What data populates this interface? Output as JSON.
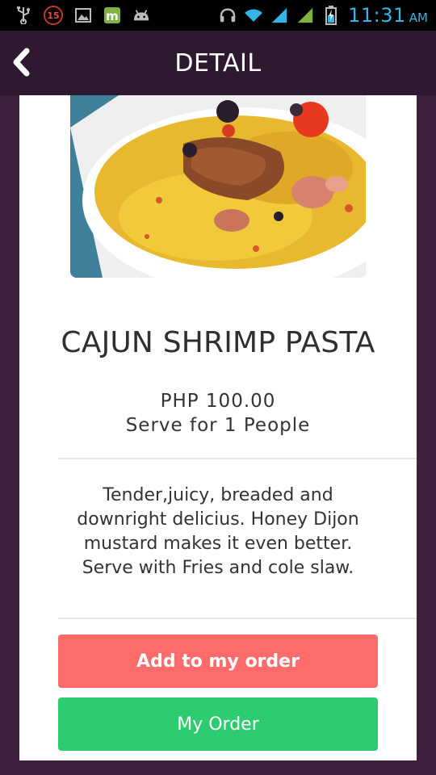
{
  "status_bar": {
    "notification_count": "15",
    "time": "11:31",
    "ampm": "AM",
    "icons": [
      "usb-icon",
      "notification-badge",
      "image-icon",
      "app-icon",
      "android-icon",
      "headset-icon",
      "wifi-icon",
      "signal-icon",
      "signal-icon",
      "battery-charging-icon"
    ],
    "accent_color": "#33b5e5"
  },
  "header": {
    "title": "DETAIL",
    "back_icon": "chevron-left-icon",
    "background": "#2e1931"
  },
  "dish": {
    "name": "CAJUN SHRIMP PASTA",
    "price": "PHP 100.00",
    "serving": "Serve for 1 People",
    "description": "Tender,juicy, breaded and downright delicius. Honey Dijon mustard makes it even better. Serve with Fries and cole slaw."
  },
  "actions": {
    "add_label": "Add to my order",
    "add_color": "#fd6b6b",
    "order_label": "My Order",
    "order_color": "#2ecc71"
  }
}
